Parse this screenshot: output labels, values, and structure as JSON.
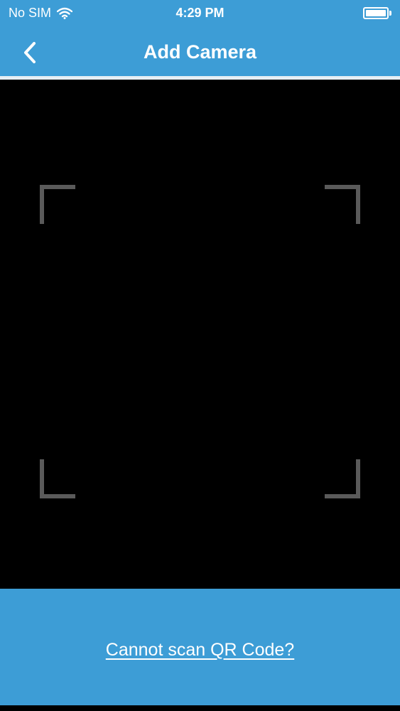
{
  "status_bar": {
    "carrier": "No SIM",
    "time": "4:29 PM",
    "icons": [
      "wifi-icon",
      "battery-icon"
    ]
  },
  "nav": {
    "title": "Add Camera",
    "back_icon": "chevron-left-icon"
  },
  "scanner": {
    "frame_icon": "scan-frame-corners"
  },
  "footer": {
    "link_label": "Cannot scan QR Code?"
  },
  "colors": {
    "primary": "#3d9dd6",
    "scanner_background": "#000000",
    "frame_corner": "#5a5a5a",
    "text": "#ffffff"
  }
}
